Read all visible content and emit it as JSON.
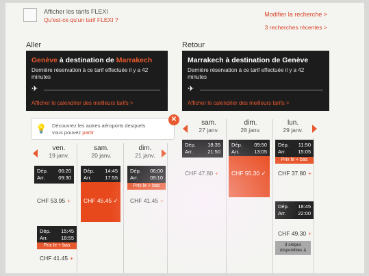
{
  "top": {
    "flexi_label": "Afficher les tarifs FLEXI",
    "flexi_link": "Qu'est-ce qu'un tarif FLEXI ?",
    "modify_link": "Modifier la recherche >",
    "recent_link": "3 recherches récentes >"
  },
  "outbound": {
    "title": "Aller",
    "route_from": "Genève",
    "route_mid": " à destination de ",
    "route_to": "Marrakech",
    "last_booking": "Dernière réservation à ce tarif effectuée il y a 42 minutes",
    "calendar_link": "Afficher le calendrier des meilleurs tarifs >",
    "tip_text": "Découvrez les autres aéroports desquels vous pouvez ",
    "tip_link": "partir",
    "days": [
      {
        "name": "ven.",
        "date": "19 janv."
      },
      {
        "name": "sam.",
        "date": "20 janv."
      },
      {
        "name": "dim.",
        "date": "21 janv."
      }
    ],
    "flights": [
      {
        "dep_label": "Dép.",
        "dep": "06:20",
        "arr_label": "Arr.",
        "arr": "09:30",
        "price": "CHF 53.95",
        "badge": ""
      },
      {
        "dep_label": "Dép.",
        "dep": "14:45",
        "arr_label": "Arr.",
        "arr": "17:55",
        "price": "CHF 45.45 ✓",
        "badge": ""
      },
      {
        "dep_label": "Dép.",
        "dep": "06:00",
        "arr_label": "Arr.",
        "arr": "09:10",
        "price": "CHF 41.45",
        "badge": "Prix le + bas"
      },
      {
        "dep_label": "Dép.",
        "dep": "15:45",
        "arr_label": "Arr.",
        "arr": "18:55",
        "price": "CHF 41.45",
        "badge": "Prix le + bas"
      }
    ]
  },
  "inbound": {
    "title": "Retour",
    "route": "Marrakech à destination de Genève",
    "last_booking": "Dernière réservation à ce tarif effectuée il y a 42 minutes",
    "calendar_link": "Afficher le calendrier des meilleurs tarifs >",
    "days": [
      {
        "name": "sam.",
        "date": "27 janv."
      },
      {
        "name": "dim.",
        "date": "28 janv."
      },
      {
        "name": "lun.",
        "date": "29 janv."
      }
    ],
    "flights": [
      {
        "dep_label": "Dép.",
        "dep": "18:35",
        "arr_label": "Arr.",
        "arr": "21:50",
        "price": "CHF 47.80",
        "badge": ""
      },
      {
        "dep_label": "Dép.",
        "dep": "09:50",
        "arr_label": "Arr.",
        "arr": "13:05",
        "price": "CHF 55.30 ✓",
        "badge": ""
      },
      {
        "dep_label": "Dép.",
        "dep": "11:50",
        "arr_label": "Arr.",
        "arr": "15:05",
        "price": "CHF 37.80",
        "badge": "Prix le + bas"
      },
      {
        "dep_label": "Dép.",
        "dep": "18:45",
        "arr_label": "Arr.",
        "arr": "22:00",
        "price": "CHF 49.30",
        "badge": ""
      }
    ],
    "seats_text": "3 sièges disponibles à"
  },
  "colors": {
    "accent": "#e8592f",
    "panel": "#1c1c1c"
  }
}
